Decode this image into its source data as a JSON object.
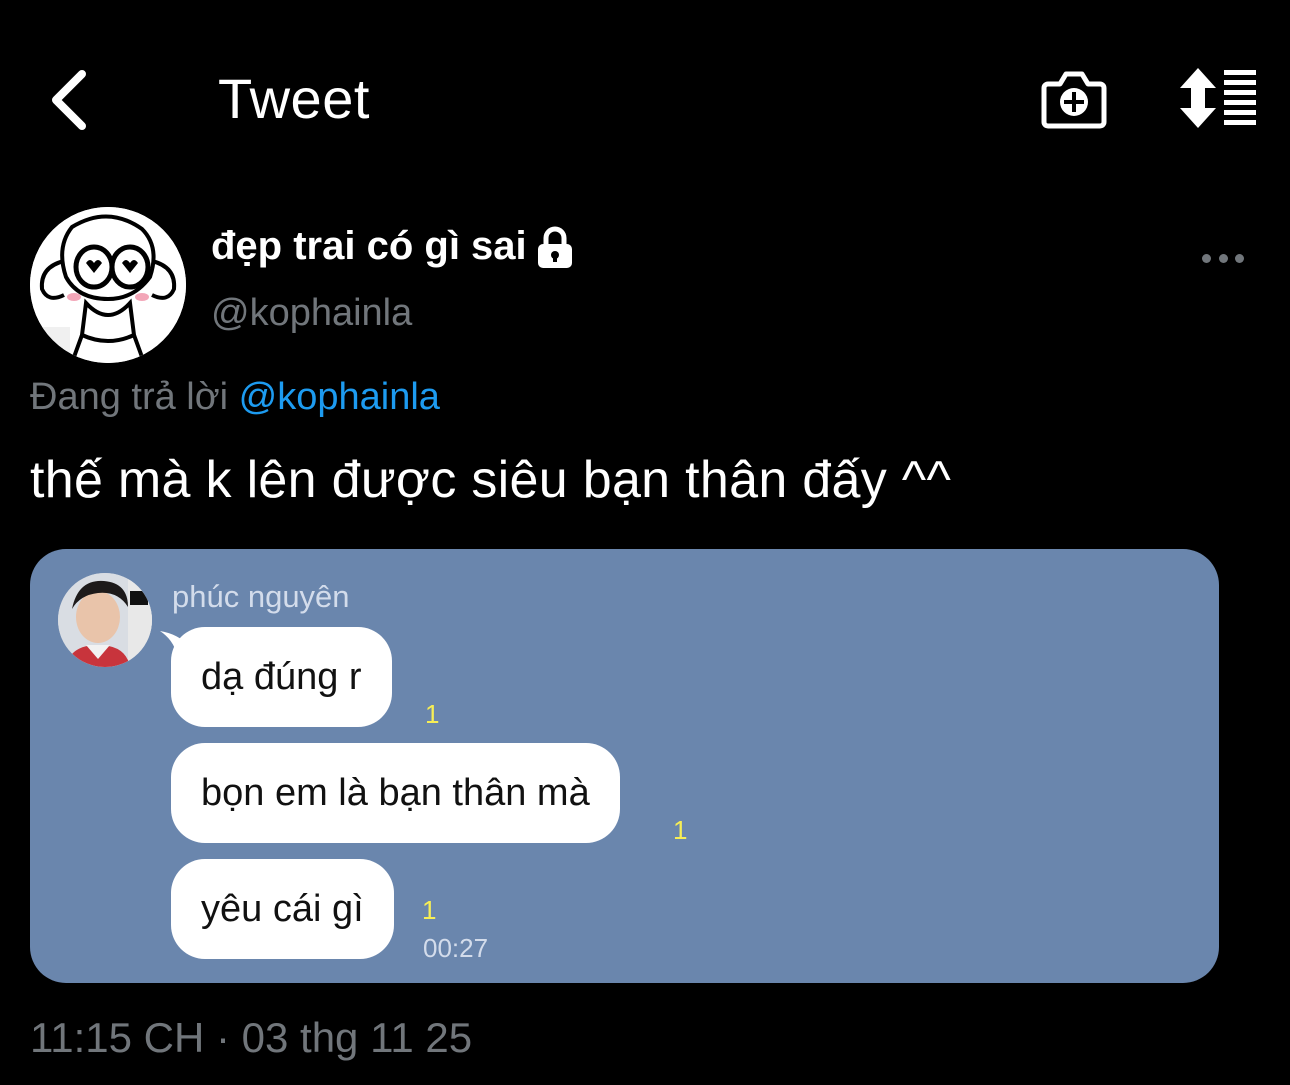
{
  "header": {
    "title": "Tweet"
  },
  "tweet": {
    "display_name": "đẹp trai có gì sai",
    "handle": "@kophainla",
    "reply_prefix": "Đang trả lời",
    "reply_mention": "@kophainla",
    "text": "thế mà k lên được siêu bạn thân đấy ^^",
    "timestamp": "11:15 CH · 03 thg 11 25"
  },
  "media": {
    "sender": "phúc nguyên",
    "messages": [
      {
        "text": "dạ đúng r",
        "read": "1"
      },
      {
        "text": "bọn em là bạn thân mà",
        "read": "1"
      },
      {
        "text": "yêu cái gì",
        "read": "1"
      }
    ],
    "time": "00:27",
    "background": "#6a86ad"
  },
  "icons": {
    "back": "chevron-left-icon",
    "camera": "camera-plus-icon",
    "sort": "sort-icon",
    "lock": "lock-icon",
    "more": "more-horizontal-icon"
  },
  "colors": {
    "background": "#000000",
    "link": "#1d9bf0",
    "secondary_text": "#71767b",
    "read_receipt": "#f7ee55"
  }
}
